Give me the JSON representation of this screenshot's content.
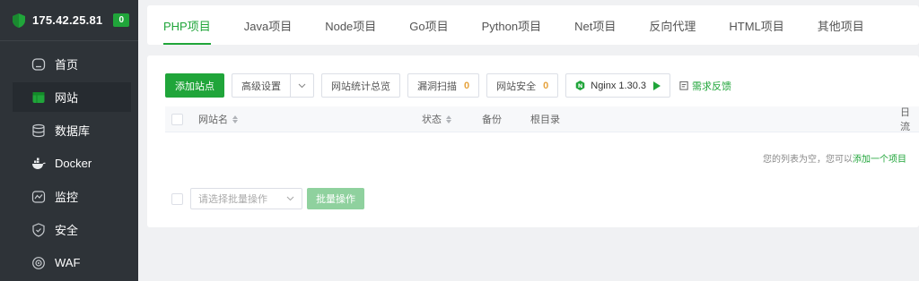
{
  "server": {
    "ip": "175.42.25.81",
    "badge": "0"
  },
  "sidebar": {
    "items": [
      {
        "label": "首页",
        "icon": "home-icon"
      },
      {
        "label": "网站",
        "icon": "website-icon",
        "active": true
      },
      {
        "label": "数据库",
        "icon": "database-icon"
      },
      {
        "label": "Docker",
        "icon": "docker-icon"
      },
      {
        "label": "监控",
        "icon": "monitor-icon"
      },
      {
        "label": "安全",
        "icon": "shield-check-icon"
      },
      {
        "label": "WAF",
        "icon": "waf-icon"
      }
    ]
  },
  "tabs": [
    {
      "label": "PHP项目",
      "active": true
    },
    {
      "label": "Java项目"
    },
    {
      "label": "Node项目"
    },
    {
      "label": "Go项目"
    },
    {
      "label": "Python项目"
    },
    {
      "label": "Net项目"
    },
    {
      "label": "反向代理"
    },
    {
      "label": "HTML项目"
    },
    {
      "label": "其他项目"
    }
  ],
  "toolbar": {
    "add_site": "添加站点",
    "advanced": "高级设置",
    "stats": "网站统计总览",
    "vuln_scan": "漏洞扫描",
    "vuln_count": "0",
    "site_security": "网站安全",
    "security_count": "0",
    "nginx": "Nginx 1.30.3",
    "feedback": "需求反馈"
  },
  "table": {
    "headers": {
      "name": "网站名",
      "status": "状态",
      "backup": "备份",
      "root": "根目录",
      "date": "日流"
    },
    "empty_text": "您的列表为空，您可以",
    "empty_link": "添加一个项目"
  },
  "batch": {
    "placeholder": "请选择批量操作",
    "button": "批量操作"
  },
  "colors": {
    "accent": "#20a53a",
    "sidebar_bg": "#2e3338",
    "warning": "#e6a23c"
  }
}
